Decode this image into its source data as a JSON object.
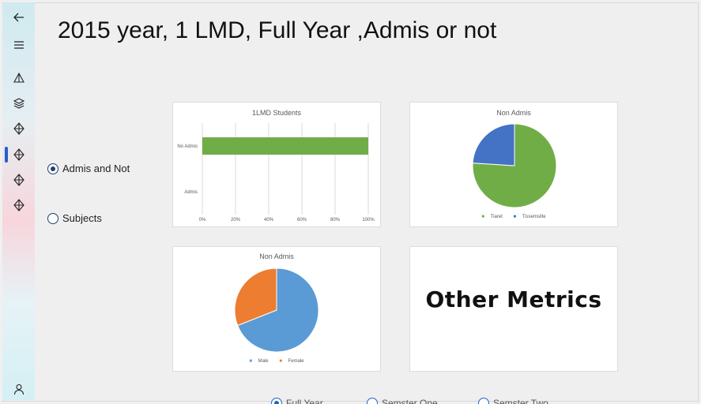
{
  "title": "2015 year, 1 LMD, Full Year ,Admis or not",
  "sidebar": {
    "items": [
      {
        "name": "back-arrow-icon"
      },
      {
        "name": "hamburger-menu-icon"
      },
      {
        "name": "pyramid-icon"
      },
      {
        "name": "layers-icon"
      },
      {
        "name": "diamond-icon"
      },
      {
        "name": "diamond-icon-active"
      },
      {
        "name": "diamond-icon"
      },
      {
        "name": "diamond-icon"
      }
    ],
    "user": {
      "name": "user-icon"
    }
  },
  "filters": {
    "options": [
      {
        "label": "Admis and Not",
        "selected": true
      },
      {
        "label": "Subjects",
        "selected": false
      }
    ]
  },
  "period": {
    "options": [
      {
        "label": "Full Year",
        "selected": true
      },
      {
        "label": "Semster One",
        "selected": false
      },
      {
        "label": "Semster Two",
        "selected": false
      }
    ]
  },
  "metrics_card": {
    "label": "Other Metrics"
  },
  "chart_data": [
    {
      "type": "bar",
      "title": "1LMD Students",
      "orientation": "horizontal",
      "categories": [
        "No Admis",
        "Admis"
      ],
      "values": [
        100,
        0
      ],
      "xlim": [
        0,
        100
      ],
      "xticks": [
        "0%",
        "20%",
        "40%",
        "60%",
        "80%",
        "100%"
      ],
      "color": "#70ad47",
      "grid": true
    },
    {
      "type": "pie",
      "title": "Non Admis",
      "labels": [
        "Tiaret",
        "Tissemsilte"
      ],
      "values": [
        76,
        24
      ],
      "colors": [
        "#70ad47",
        "#4472c4"
      ],
      "legend": "bottom"
    },
    {
      "type": "pie",
      "title": "Non Admis",
      "labels": [
        "Male",
        "Female"
      ],
      "values": [
        69,
        31
      ],
      "colors": [
        "#5b9bd5",
        "#ed7d31"
      ],
      "legend": "bottom"
    }
  ]
}
